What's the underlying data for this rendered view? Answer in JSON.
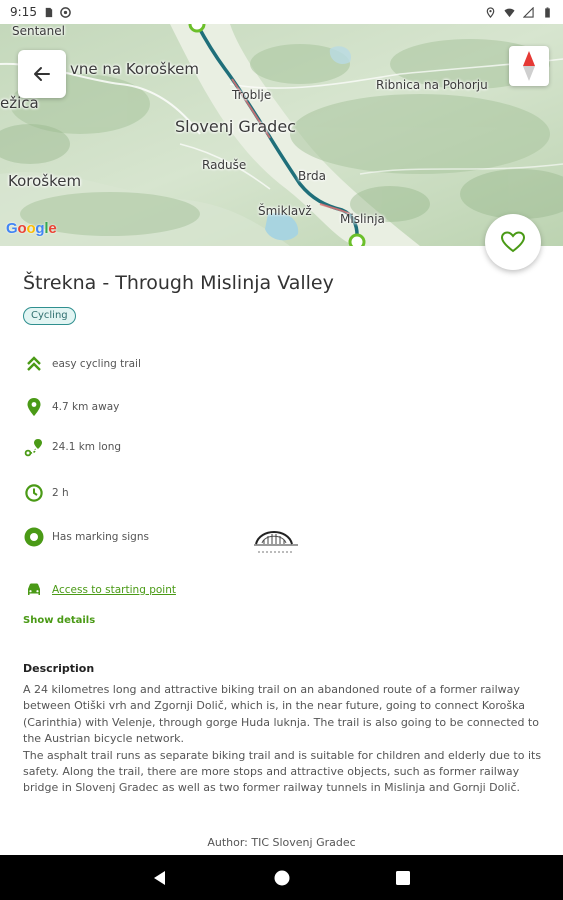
{
  "status_bar": {
    "time": "9:15",
    "icons": [
      "sim-card-icon",
      "sync-icon",
      "location-icon",
      "wifi-icon",
      "signal-icon",
      "battery-icon"
    ]
  },
  "map": {
    "labels": [
      {
        "text": "Sentanel"
      },
      {
        "text": "vne na Koroškem"
      },
      {
        "text": "Troblje"
      },
      {
        "text": "Ribnica na Pohorju"
      },
      {
        "text": "ežica"
      },
      {
        "text": "Slovenj Gradec"
      },
      {
        "text": "Raduše"
      },
      {
        "text": "Brda"
      },
      {
        "text": "Koroškem"
      },
      {
        "text": "Šmiklavž"
      },
      {
        "text": "Mislinja"
      }
    ],
    "google_logo": "Google",
    "route_color": "#1f6f7a",
    "back_icon": "arrow-back-icon",
    "compass_icon": "compass-icon"
  },
  "favorite_icon": "heart-outline-icon",
  "trail": {
    "title": "Štrekna - Through Mislinja Valley",
    "category": "Cycling",
    "accent_color": "#4a9a16",
    "info": [
      {
        "icon": "difficulty-icon",
        "text": "easy cycling trail"
      },
      {
        "icon": "location-pin-icon",
        "text": "4.7 km away"
      },
      {
        "icon": "route-length-icon",
        "text": "24.1 km long"
      },
      {
        "icon": "clock-icon",
        "text": "2 h"
      },
      {
        "icon": "marking-signs-icon",
        "text": "Has marking signs"
      }
    ],
    "access_link": "Access to starting point",
    "show_details": "Show details"
  },
  "description": {
    "heading": "Description",
    "paragraphs": [
      "A 24 kilometres long and attractive biking trail on an abandoned route of a former railway between Otiški vrh and Zgornji Dolič, which is, in the near future, going to connect Koroška (Carinthia) with Velenje, through gorge Huda luknja. The trail is also going to be connected to the Austrian bicycle network.",
      "The asphalt trail runs as separate biking trail and is suitable for children and elderly due to its safety. Along the trail, there are more stops and attractive objects, such as former railway bridge in Slovenj Gradec as well as two former railway tunnels in Mislinja and Gornji Dolič."
    ],
    "author": "Author: TIC Slovenj Gradec"
  },
  "nav_bar": {
    "icons": [
      "back-triangle-icon",
      "home-circle-icon",
      "recents-square-icon"
    ]
  }
}
